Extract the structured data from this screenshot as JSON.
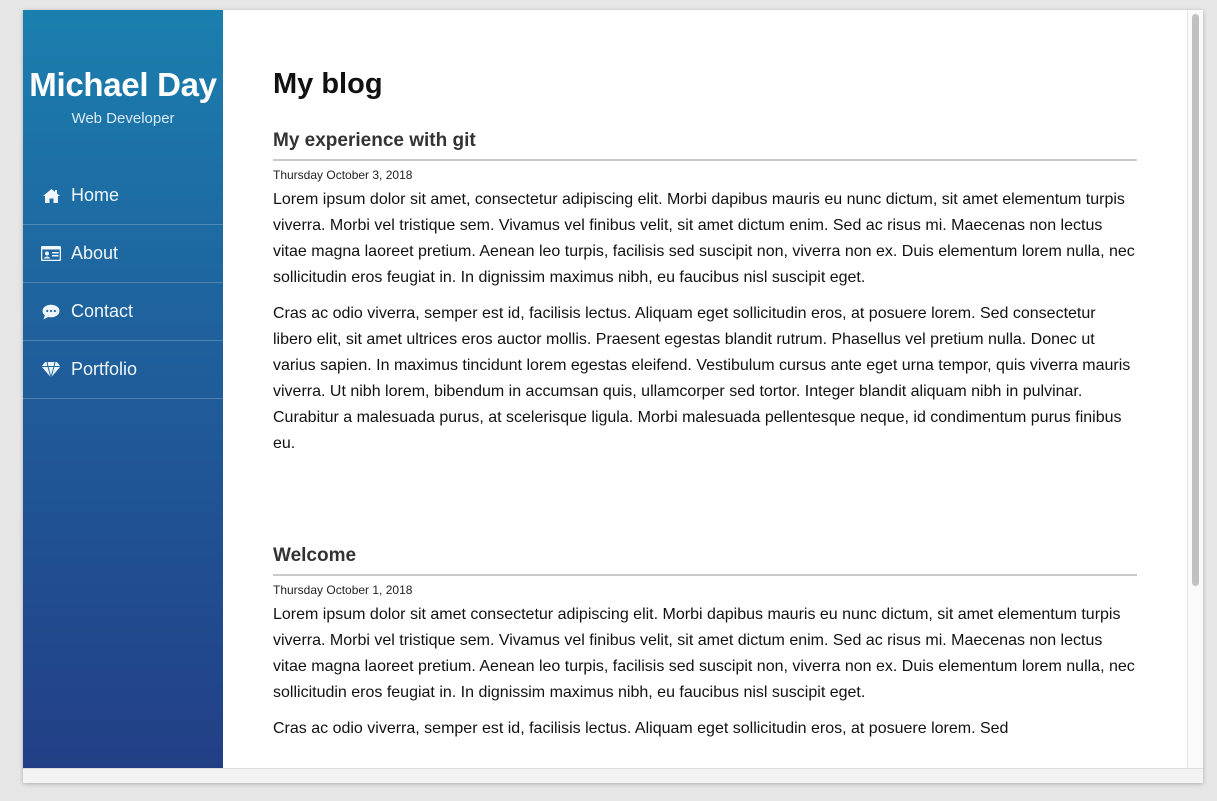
{
  "sidebar": {
    "name": "Michael Day",
    "role": "Web Developer",
    "nav": [
      {
        "label": "Home",
        "icon": "home-icon"
      },
      {
        "label": "About",
        "icon": "id-card-icon"
      },
      {
        "label": "Contact",
        "icon": "chat-bubble-icon"
      },
      {
        "label": "Portfolio",
        "icon": "diamond-icon"
      }
    ]
  },
  "main": {
    "title": "My blog",
    "posts": [
      {
        "title": "My experience with git",
        "date": "Thursday October 3, 2018",
        "paragraphs": [
          "Lorem ipsum dolor sit amet, consectetur adipiscing elit. Morbi dapibus mauris eu nunc dictum, sit amet elementum turpis viverra. Morbi vel tristique sem. Vivamus vel finibus velit, sit amet dictum enim. Sed ac risus mi. Maecenas non lectus vitae magna laoreet pretium. Aenean leo turpis, facilisis sed suscipit non, viverra non ex. Duis elementum lorem nulla, nec sollicitudin eros feugiat in. In dignissim maximus nibh, eu faucibus nisl suscipit eget.",
          "Cras ac odio viverra, semper est id, facilisis lectus. Aliquam eget sollicitudin eros, at posuere lorem. Sed consectetur libero elit, sit amet ultrices eros auctor mollis. Praesent egestas blandit rutrum. Phasellus vel pretium nulla. Donec ut varius sapien. In maximus tincidunt lorem egestas eleifend. Vestibulum cursus ante eget urna tempor, quis viverra mauris viverra. Ut nibh lorem, bibendum in accumsan quis, ullamcorper sed tortor. Integer blandit aliquam nibh in pulvinar. Curabitur a malesuada purus, at scelerisque ligula. Morbi malesuada pellentesque neque, id condimentum purus finibus eu."
        ]
      },
      {
        "title": "Welcome",
        "date": "Thursday October 1, 2018",
        "paragraphs": [
          "Lorem ipsum dolor sit amet consectetur adipiscing elit. Morbi dapibus mauris eu nunc dictum, sit amet elementum turpis viverra. Morbi vel tristique sem. Vivamus vel finibus velit, sit amet dictum enim. Sed ac risus mi. Maecenas non lectus vitae magna laoreet pretium. Aenean leo turpis, facilisis sed suscipit non, viverra non ex. Duis elementum lorem nulla, nec sollicitudin eros feugiat in. In dignissim maximus nibh, eu faucibus nisl suscipit eget.",
          "Cras ac odio viverra, semper est id, facilisis lectus. Aliquam eget sollicitudin eros, at posuere lorem. Sed"
        ]
      }
    ]
  },
  "colors": {
    "sidebar_top": "#1b7fae",
    "sidebar_bottom": "#223f86",
    "rule": "#c9c9c9"
  }
}
